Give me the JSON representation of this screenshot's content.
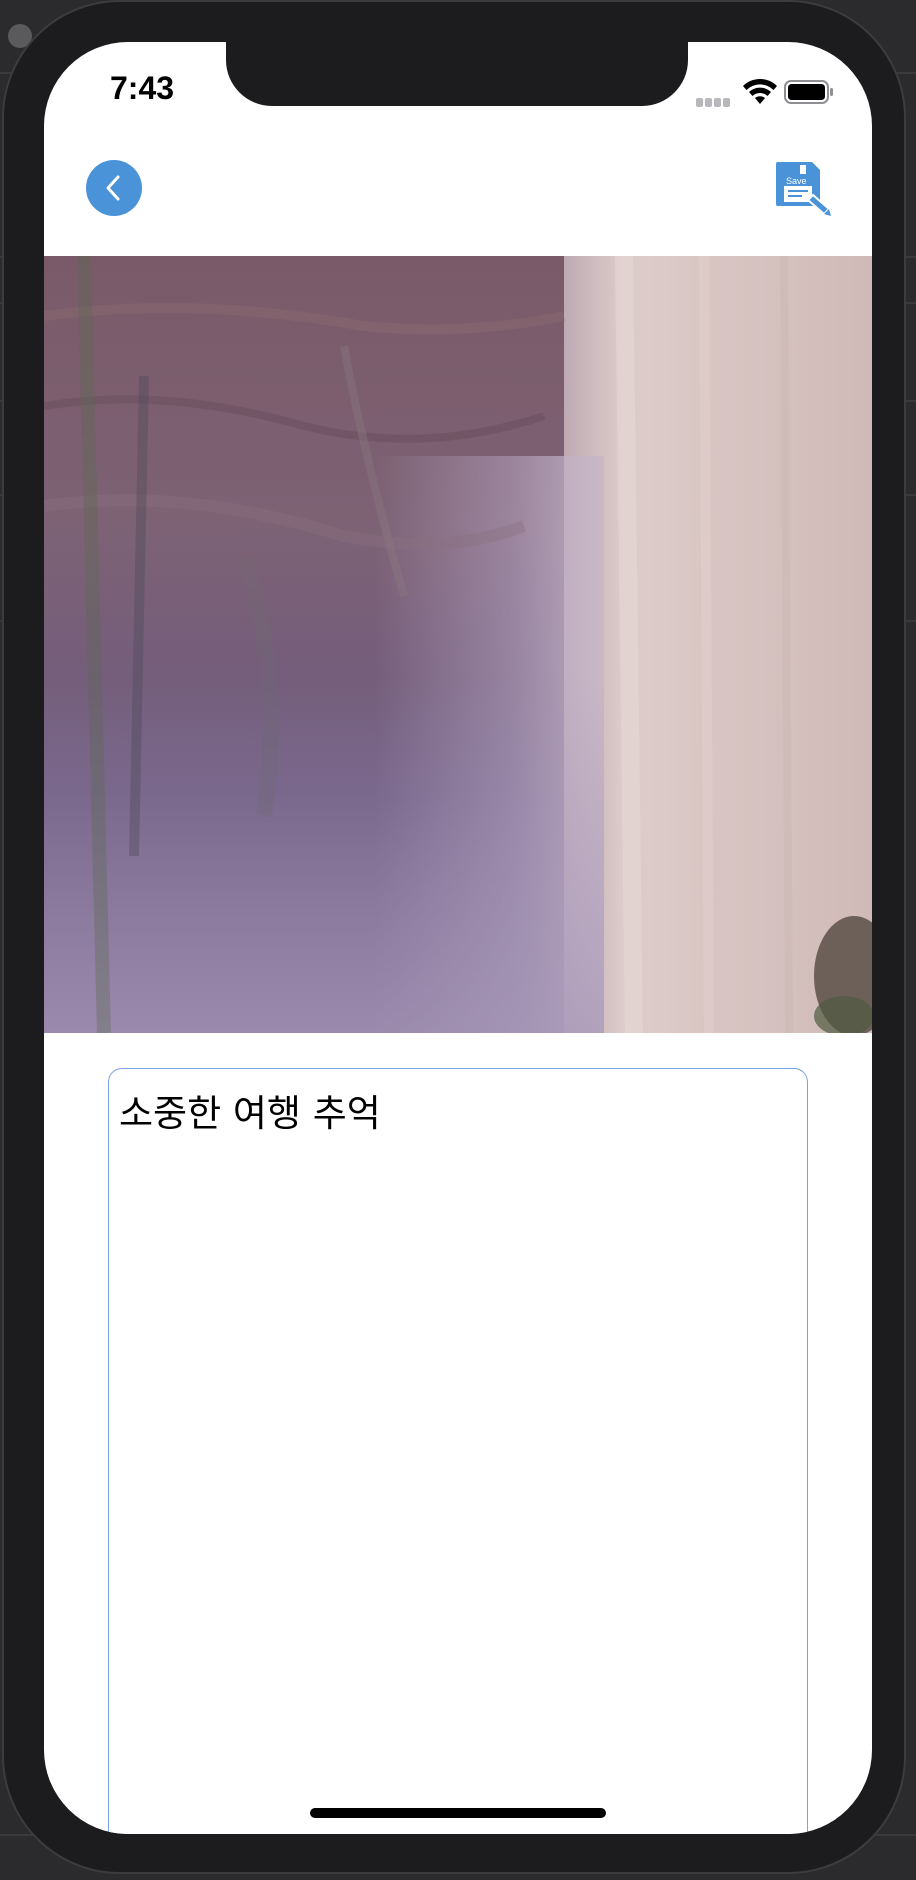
{
  "status_bar": {
    "time": "7:43"
  },
  "nav": {
    "back_icon": "chevron-left-icon",
    "save_label": "Save",
    "save_icon": "floppy-disk-edit-icon",
    "accent_color": "#4a93d8"
  },
  "photo": {
    "description_icon": "waterfall-photo"
  },
  "memo": {
    "value": "소중한 여행 추억"
  },
  "colors": {
    "accent": "#4a93d8",
    "field_border": "#7aa0e8"
  }
}
